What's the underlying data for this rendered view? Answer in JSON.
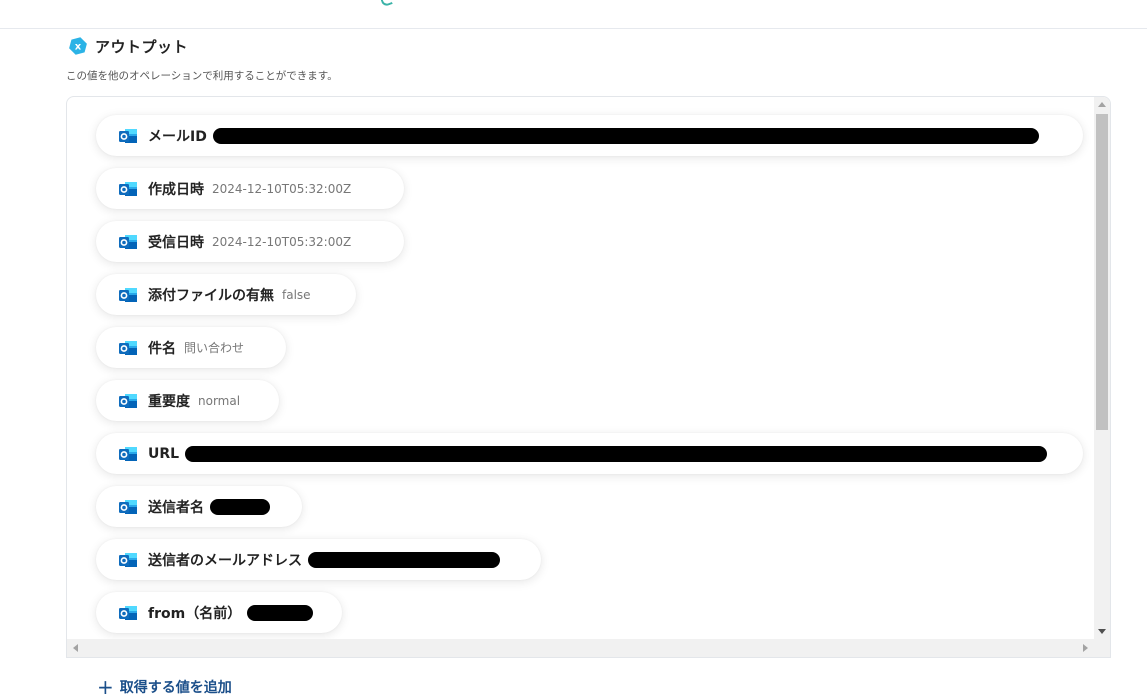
{
  "section": {
    "title": "アウトプット",
    "description": "この値を他のオペレーションで利用することができます。"
  },
  "outputs": [
    {
      "label": "メールID",
      "value": "",
      "redacted": true
    },
    {
      "label": "作成日時",
      "value": "2024-12-10T05:32:00Z",
      "redacted": false
    },
    {
      "label": "受信日時",
      "value": "2024-12-10T05:32:00Z",
      "redacted": false
    },
    {
      "label": "添付ファイルの有無",
      "value": "false",
      "redacted": false
    },
    {
      "label": "件名",
      "value": "問い合わせ",
      "redacted": false
    },
    {
      "label": "重要度",
      "value": "normal",
      "redacted": false
    },
    {
      "label": "URL",
      "value": "",
      "redacted": true
    },
    {
      "label": "送信者名",
      "value": "",
      "redacted": true
    },
    {
      "label": "送信者のメールアドレス",
      "value": "",
      "redacted": true
    },
    {
      "label": "from（名前）",
      "value": "",
      "redacted": true
    }
  ],
  "add_button": {
    "icon": "plus-icon",
    "label": "取得する値を追加"
  },
  "colors": {
    "accent": "#1b4f8a",
    "section_icon": "#2bb3e6",
    "outlook_icon": "#0f6cbd"
  },
  "icons": {
    "section": "hexagon-x-icon",
    "item": "outlook-icon"
  }
}
